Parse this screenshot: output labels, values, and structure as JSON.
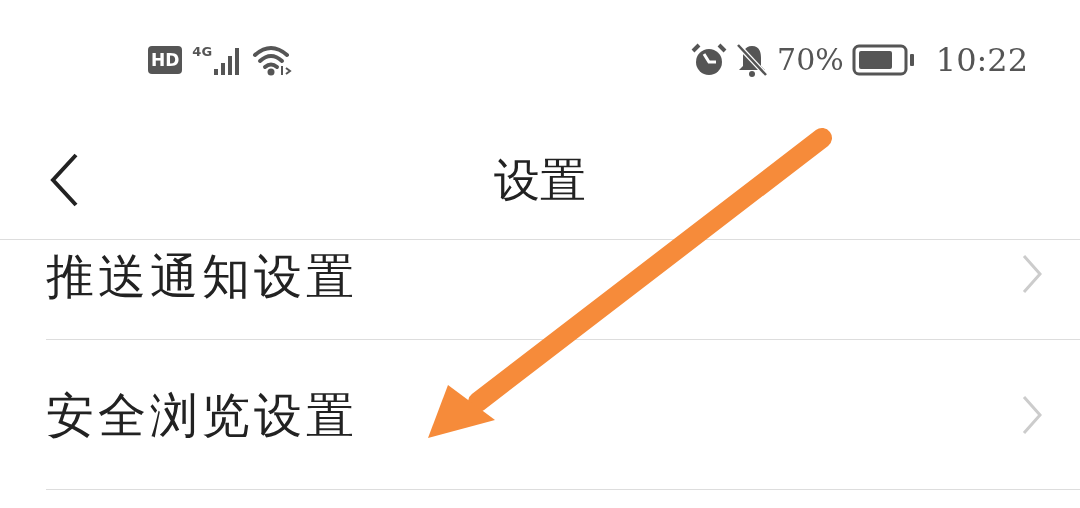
{
  "status_bar": {
    "hd": "HD",
    "network": "4G",
    "battery": "70%",
    "time": "10:22"
  },
  "header": {
    "title": "设置"
  },
  "items": [
    {
      "label": "推送通知设置"
    },
    {
      "label": "安全浏览设置"
    }
  ]
}
